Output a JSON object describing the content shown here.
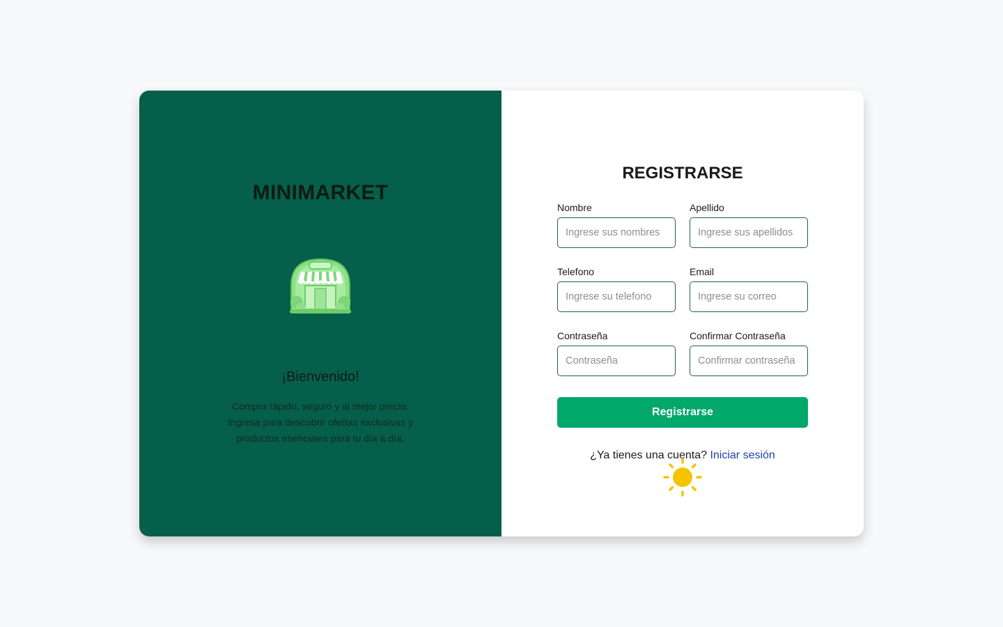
{
  "brand": {
    "name": "MINIMARKET",
    "welcome": "¡Bienvenido!",
    "description": "Compra rápido, seguro y al mejor precio. Ingresa para descubrir ofertas exclusivas y productos esenciales para tu día a día.",
    "icon": "store-icon",
    "panel_color": "#065f4a"
  },
  "form": {
    "title": "REGISTRARSE",
    "fields": {
      "nombre": {
        "label": "Nombre",
        "placeholder": "Ingrese sus nombres",
        "value": ""
      },
      "apellido": {
        "label": "Apellido",
        "placeholder": "Ingrese sus apellidos",
        "value": ""
      },
      "telefono": {
        "label": "Telefono",
        "placeholder": "Ingrese su telefono",
        "value": ""
      },
      "email": {
        "label": "Email",
        "placeholder": "Ingrese su correo",
        "value": ""
      },
      "password": {
        "label": "Contraseña",
        "placeholder": "Contraseña",
        "value": ""
      },
      "confirm_password": {
        "label": "Confirmar Contraseña",
        "placeholder": "Confirmar contraseña",
        "value": ""
      }
    },
    "submit_label": "Registrarse",
    "submit_color": "#02a76a",
    "login_prompt": "¿Ya tienes una cuenta?",
    "login_link": "Iniciar sesión"
  },
  "theme_toggle": {
    "icon": "sun-icon",
    "color": "#f5c400"
  }
}
